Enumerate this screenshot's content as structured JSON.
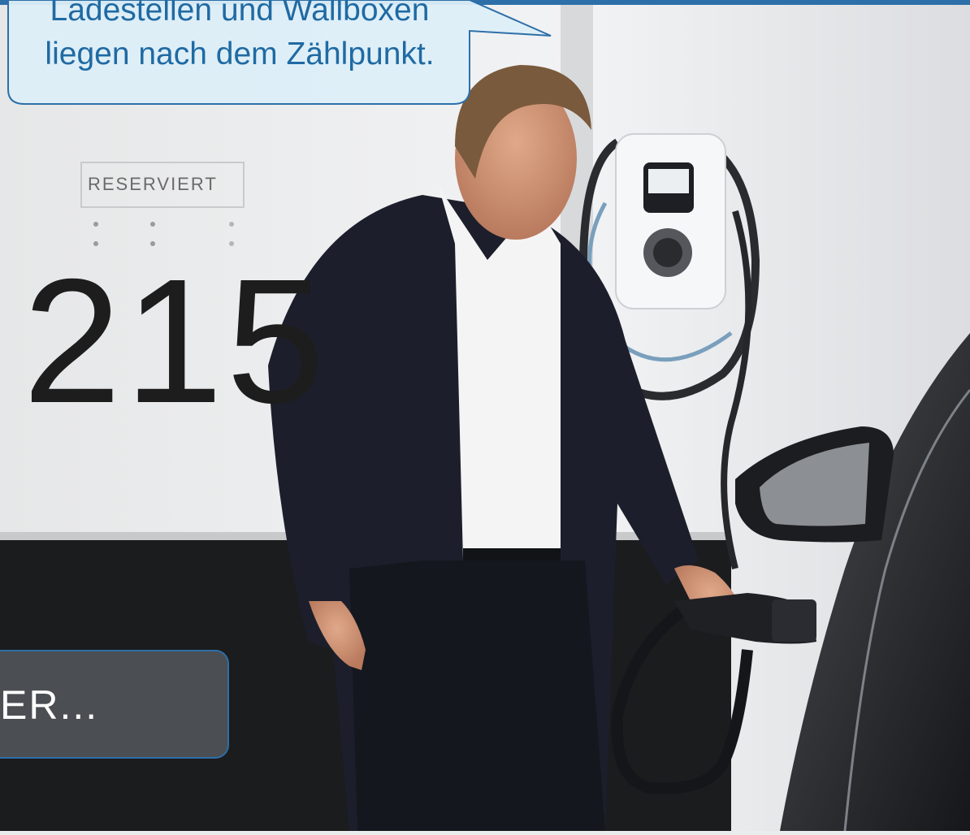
{
  "speech_bubble": {
    "text": "Ladestellen und Wallboxen\nliegen nach dem Zählpunkt."
  },
  "scene": {
    "reserved_sign": "RESERVIERT",
    "parking_number": "215"
  },
  "nav_card": {
    "label": "ER..."
  },
  "colors": {
    "accent_blue": "#2d6fa8",
    "bubble_fill": "#ddeef8",
    "card_fill": "#4f5257"
  }
}
